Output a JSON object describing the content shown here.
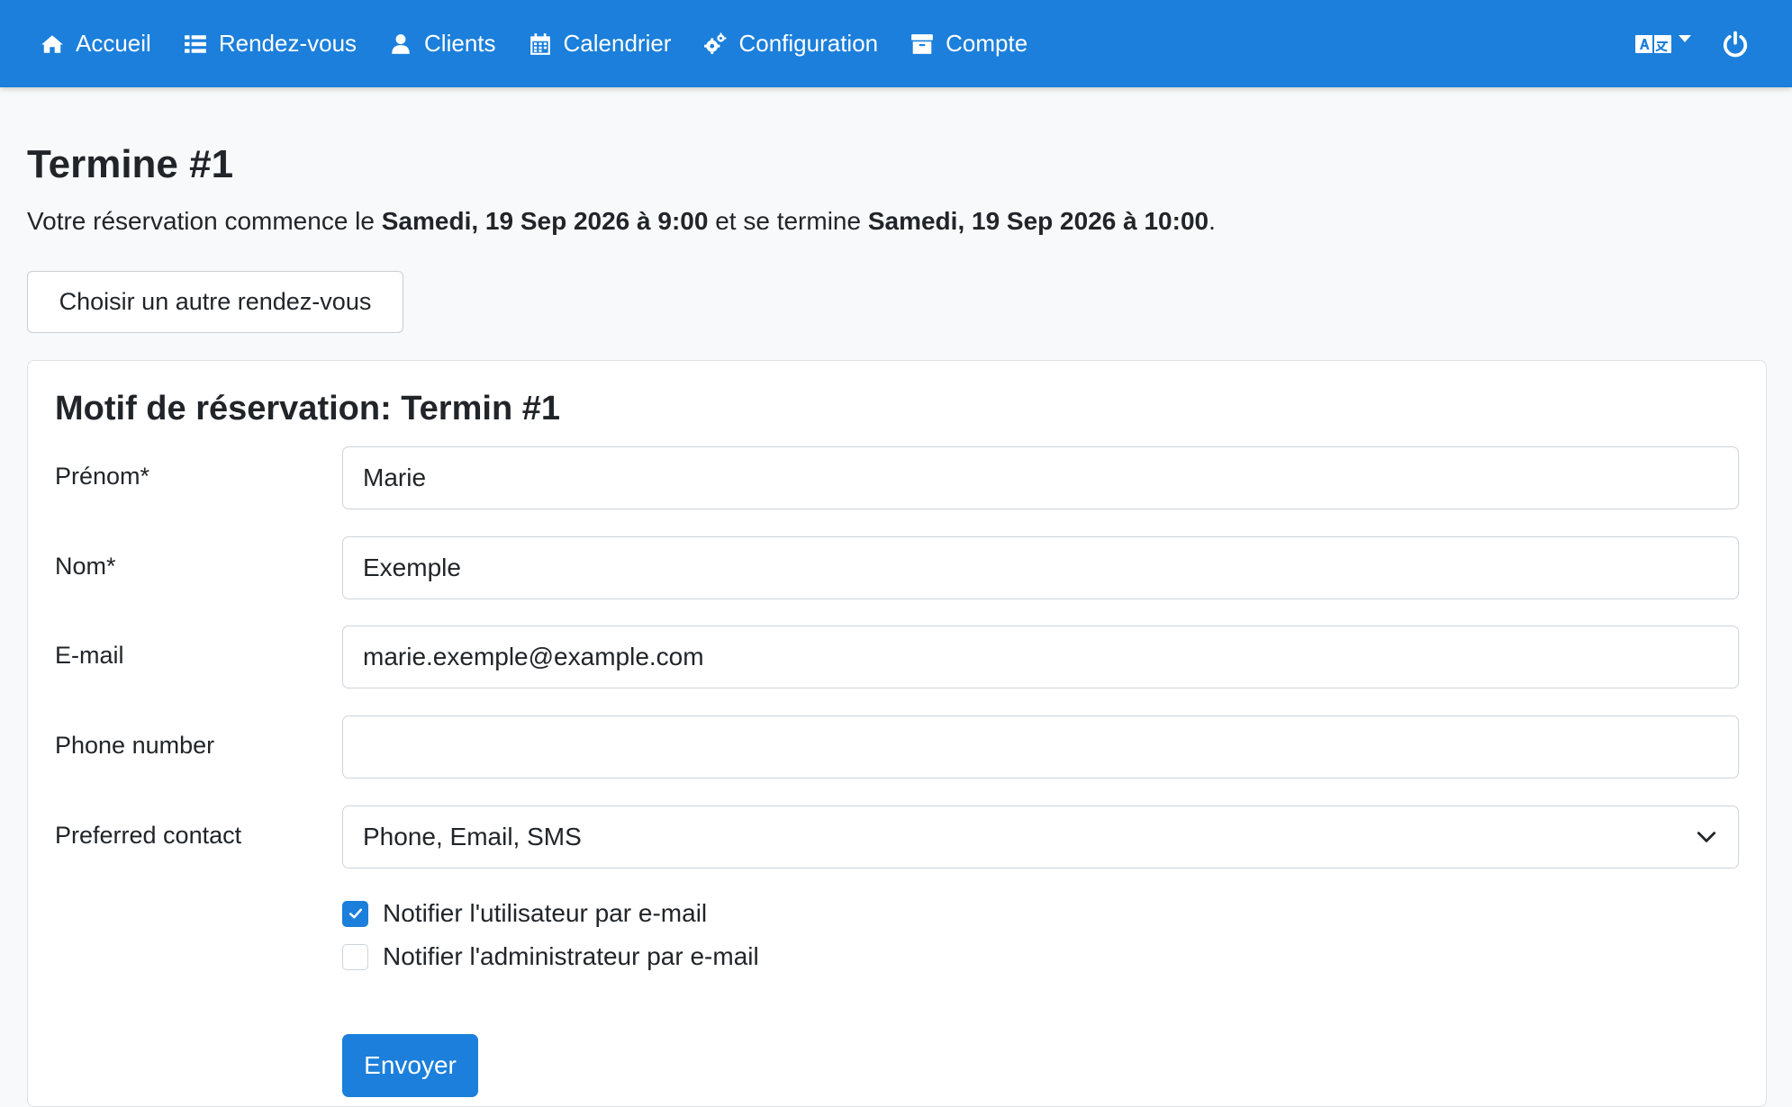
{
  "nav": {
    "items": [
      {
        "label": "Accueil",
        "icon": "home-icon"
      },
      {
        "label": "Rendez-vous",
        "icon": "list-icon"
      },
      {
        "label": "Clients",
        "icon": "user-icon"
      },
      {
        "label": "Calendrier",
        "icon": "calendar-icon"
      },
      {
        "label": "Configuration",
        "icon": "cogs-icon"
      },
      {
        "label": "Compte",
        "icon": "archive-icon"
      }
    ],
    "right": {
      "language_icon": "translate-icon",
      "power_icon": "power-icon"
    }
  },
  "page": {
    "title": "Termine #1",
    "summary_prefix": "Votre réservation commence le ",
    "start": "Samedi, 19 Sep 2026 à 9:00",
    "summary_middle": " et se termine ",
    "end": "Samedi, 19 Sep 2026 à 10:00",
    "summary_suffix": ".",
    "alt_button": "Choisir un autre rendez-vous"
  },
  "form": {
    "title": "Motif de réservation: Termin #1",
    "fields": [
      {
        "label": "Prénom*",
        "value": "Marie"
      },
      {
        "label": "Nom*",
        "value": "Exemple"
      },
      {
        "label": "E-mail",
        "value": "marie.exemple@example.com"
      },
      {
        "label": "Phone number",
        "value": ""
      }
    ],
    "contact": {
      "label": "Preferred contact",
      "value": "Phone, Email, SMS"
    },
    "checkboxes": [
      {
        "label": "Notifier l'utilisateur par e-mail",
        "checked": true
      },
      {
        "label": "Notifier l'administrateur par e-mail",
        "checked": false
      }
    ],
    "submit": "Envoyer"
  },
  "colors": {
    "primary": "#1b7fdb",
    "background": "#f8f9fa"
  }
}
